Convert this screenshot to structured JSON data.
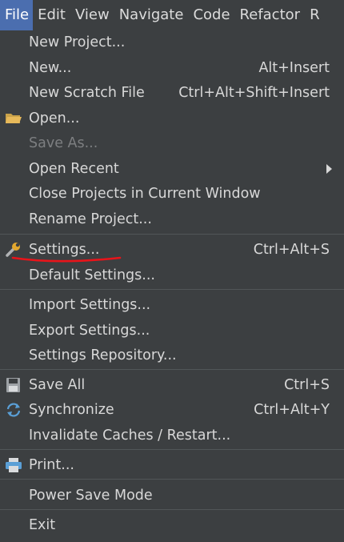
{
  "menubar": {
    "items": [
      {
        "label": "File"
      },
      {
        "label": "Edit"
      },
      {
        "label": "View"
      },
      {
        "label": "Navigate"
      },
      {
        "label": "Code"
      },
      {
        "label": "Refactor"
      },
      {
        "label": "R"
      }
    ]
  },
  "file_menu": {
    "items": [
      {
        "label": "New Project...",
        "shortcut": ""
      },
      {
        "label": "New...",
        "shortcut": "Alt+Insert"
      },
      {
        "label": "New Scratch File",
        "shortcut": "Ctrl+Alt+Shift+Insert"
      },
      {
        "label": "Open...",
        "shortcut": "",
        "icon": "folder-icon"
      },
      {
        "label": "Save As...",
        "shortcut": "",
        "disabled": true
      },
      {
        "label": "Open Recent",
        "shortcut": "",
        "submenu": true
      },
      {
        "label": "Close Projects in Current Window",
        "shortcut": ""
      },
      {
        "label": "Rename Project...",
        "shortcut": ""
      },
      {
        "label": "Settings...",
        "shortcut": "Ctrl+Alt+S",
        "icon": "wrench-icon"
      },
      {
        "label": "Default Settings...",
        "shortcut": ""
      },
      {
        "label": "Import Settings...",
        "shortcut": ""
      },
      {
        "label": "Export Settings...",
        "shortcut": ""
      },
      {
        "label": "Settings Repository...",
        "shortcut": ""
      },
      {
        "label": "Save All",
        "shortcut": "Ctrl+S",
        "icon": "floppy-disk-icon"
      },
      {
        "label": "Synchronize",
        "shortcut": "Ctrl+Alt+Y",
        "icon": "sync-icon"
      },
      {
        "label": "Invalidate Caches / Restart...",
        "shortcut": ""
      },
      {
        "label": "Print...",
        "shortcut": "",
        "icon": "printer-icon"
      },
      {
        "label": "Power Save Mode",
        "shortcut": ""
      },
      {
        "label": "Exit",
        "shortcut": ""
      }
    ]
  },
  "colors": {
    "menu_background": "#3c3f41",
    "active_menu": "#4b6eaf",
    "text": "#d8d8d8",
    "disabled_text": "#7d7f81",
    "annotation_underline": "#e8141a"
  }
}
